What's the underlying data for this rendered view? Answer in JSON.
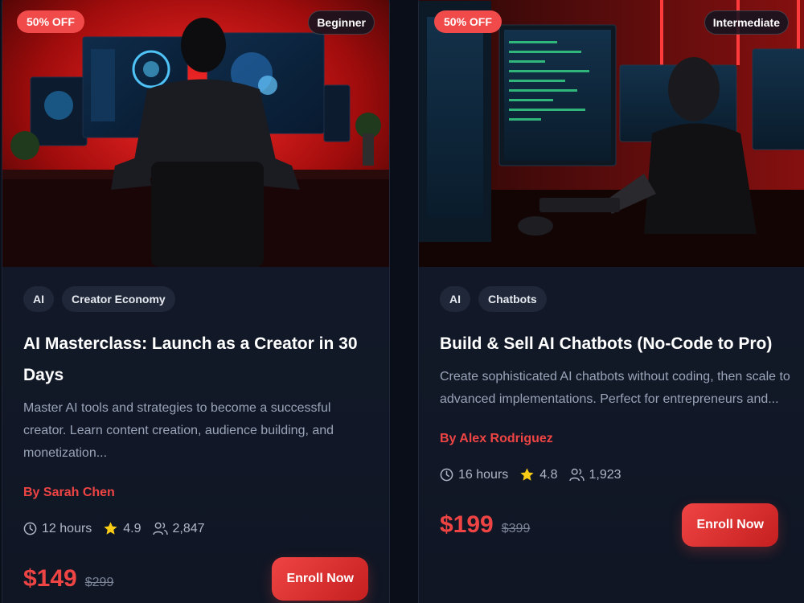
{
  "courses": [
    {
      "discount": "50% OFF",
      "level": "Beginner",
      "tags": [
        "AI",
        "Creator Economy"
      ],
      "title": "AI Masterclass: Launch as a Creator in 30 Days",
      "description": "Master AI tools and strategies to become a successful creator. Learn content creation, audience building, and monetization...",
      "author": "By Sarah Chen",
      "duration": "12 hours",
      "rating": "4.9",
      "students": "2,847",
      "price": "$149",
      "old_price": "$299",
      "cta": "Enroll Now"
    },
    {
      "discount": "50% OFF",
      "level": "Intermediate",
      "tags": [
        "AI",
        "Chatbots"
      ],
      "title": "Build & Sell AI Chatbots (No-Code to Pro)",
      "description": "Create sophisticated AI chatbots without coding, then scale to advanced implementations. Perfect for entrepreneurs and...",
      "author": "By Alex Rodriguez",
      "duration": "16 hours",
      "rating": "4.8",
      "students": "1,923",
      "price": "$199",
      "old_price": "$399",
      "cta": "Enroll Now"
    }
  ],
  "colors": {
    "accent": "#ef4444",
    "card_bg": "#131a2a",
    "tag_bg": "#1f2738",
    "star": "#facc15"
  },
  "icons": {
    "duration": "clock-icon",
    "rating": "star-icon",
    "students": "users-icon"
  }
}
